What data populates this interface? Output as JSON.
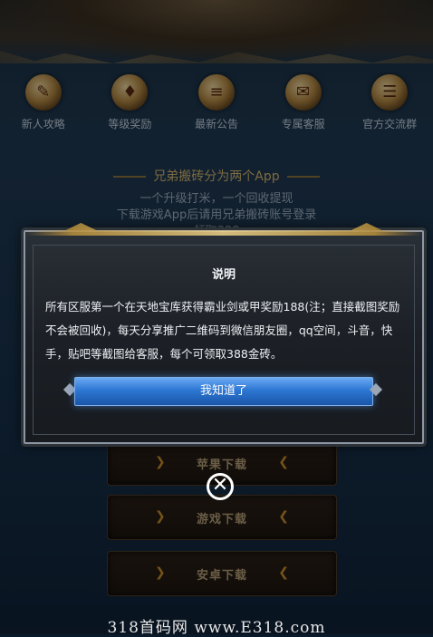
{
  "nav": [
    {
      "label": "新人攻略",
      "icon": "scroll-icon"
    },
    {
      "label": "等级奖励",
      "icon": "treasure-bag-icon"
    },
    {
      "label": "最新公告",
      "icon": "scroll-announcement-icon"
    },
    {
      "label": "专属客服",
      "icon": "letter-icon"
    },
    {
      "label": "官方交流群",
      "icon": "map-scroll-icon"
    }
  ],
  "info": {
    "title": "兄弟搬砖分为两个App",
    "line1": "一个升级打米，一个回收提现",
    "line2": "下载游戏App后请用兄弟搬砖账号登录",
    "line3": "领取388"
  },
  "downloads": [
    {
      "label": "苹果下载"
    },
    {
      "label": "游戏下载"
    },
    {
      "label": "安卓下载"
    }
  ],
  "dialog": {
    "title": "说明",
    "message": "所有区服第一个在天地宝库获得霸业剑或甲奖励188(注；直接截图奖励不会被回收)，每天分享推广二维码到微信朋友圈，qq空间，斗音，快手，贴吧等截图给客服，每个可领取388金砖。",
    "confirm_label": "我知道了"
  },
  "close_glyph": "✕",
  "watermark": "318首码网 www.E318.com",
  "colors": {
    "accent_blue": "#2d77d3",
    "gold": "#d6b870"
  }
}
